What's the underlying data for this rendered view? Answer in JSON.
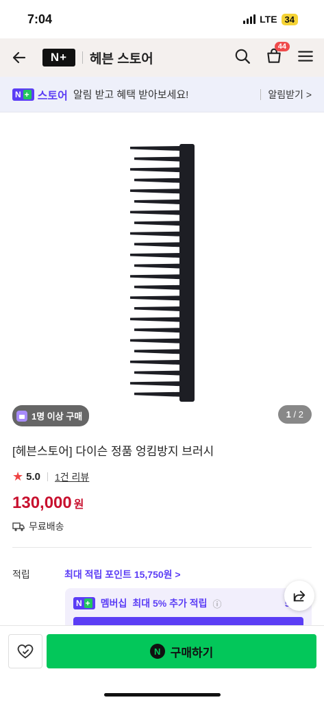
{
  "status": {
    "time": "7:04",
    "network": "LTE",
    "battery": "34"
  },
  "header": {
    "logo": "N+",
    "store_name": "헤븐 스토어",
    "cart_count": "44"
  },
  "banner": {
    "logo": "N+",
    "store": "스토어",
    "text": "알림 받고 혜택 받아보세요!",
    "cta": "알림받기 >"
  },
  "gallery": {
    "badge": "1명 이상 구매",
    "page_current": "1",
    "page_total": "/ 2"
  },
  "product": {
    "title": "[헤븐스토어] 다이슨 정품 엉킴방지 브러시",
    "rating": "5.0",
    "reviews": "1건 리뷰",
    "price": "130,000",
    "price_unit": "원",
    "shipping": "무료배송"
  },
  "points": {
    "label": "적립",
    "max_text": "최대 적립 포인트 15,750원 >",
    "member_tag": "멤버십",
    "member_text": "최대 5% 추가 적립",
    "member_points": "5,20"
  },
  "bottom": {
    "buy_label": "구매하기",
    "buy_icon": "N"
  },
  "colors": {
    "accent": "#5b3df5",
    "price": "#c8102e",
    "buy": "#03c75a"
  },
  "icons": [
    "back-icon",
    "search-icon",
    "cart-icon",
    "menu-icon",
    "share-icon",
    "heart-check-icon",
    "truck-icon"
  ]
}
